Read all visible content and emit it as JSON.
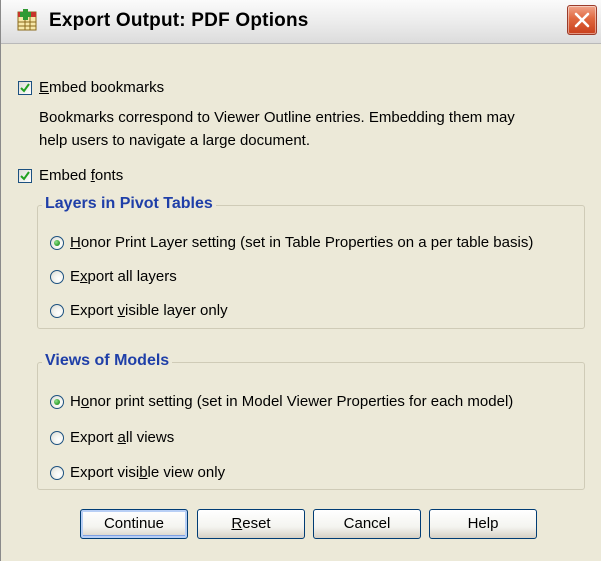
{
  "window": {
    "title": "Export Output: PDF Options"
  },
  "options": {
    "embed_bookmarks": {
      "label_pre": "",
      "label_key": "E",
      "label_post": "mbed bookmarks",
      "checked": true
    },
    "description_line1": "Bookmarks correspond to Viewer Outline entries. Embedding them may",
    "description_line2": "help users to navigate a large document.",
    "embed_fonts": {
      "label_pre": "Embed ",
      "label_key": "f",
      "label_post": "onts",
      "checked": true
    }
  },
  "layers_group": {
    "title": "Layers in Pivot Tables",
    "options": [
      {
        "pre": "",
        "key": "H",
        "post": "onor Print Layer setting (set in Table Properties on a per table basis)",
        "selected": true
      },
      {
        "pre": "E",
        "key": "x",
        "post": "port all layers",
        "selected": false
      },
      {
        "pre": "Export ",
        "key": "v",
        "post": "isible layer only",
        "selected": false
      }
    ]
  },
  "views_group": {
    "title": "Views of Models",
    "options": [
      {
        "pre": "H",
        "key": "o",
        "post": "nor print setting (set in Model Viewer Properties for each model)",
        "selected": true
      },
      {
        "pre": "Export ",
        "key": "a",
        "post": "ll views",
        "selected": false
      },
      {
        "pre": "Export visi",
        "key": "b",
        "post": "le view only",
        "selected": false
      }
    ]
  },
  "buttons": {
    "continue": {
      "pre": "",
      "key": "",
      "post": "Continue"
    },
    "reset": {
      "pre": "",
      "key": "R",
      "post": "eset"
    },
    "cancel": {
      "pre": "",
      "key": "",
      "post": "Cancel"
    },
    "help": {
      "pre": "",
      "key": "",
      "post": "Help"
    }
  },
  "colors": {
    "dialog_bg": "#ece9d8",
    "group_title": "#1f3fa8",
    "close_button": "#e0683f",
    "radio_selected": "#2d9b2a"
  },
  "icons": {
    "app": "spss-grid-icon",
    "close": "close-icon",
    "check": "checkmark-icon"
  }
}
